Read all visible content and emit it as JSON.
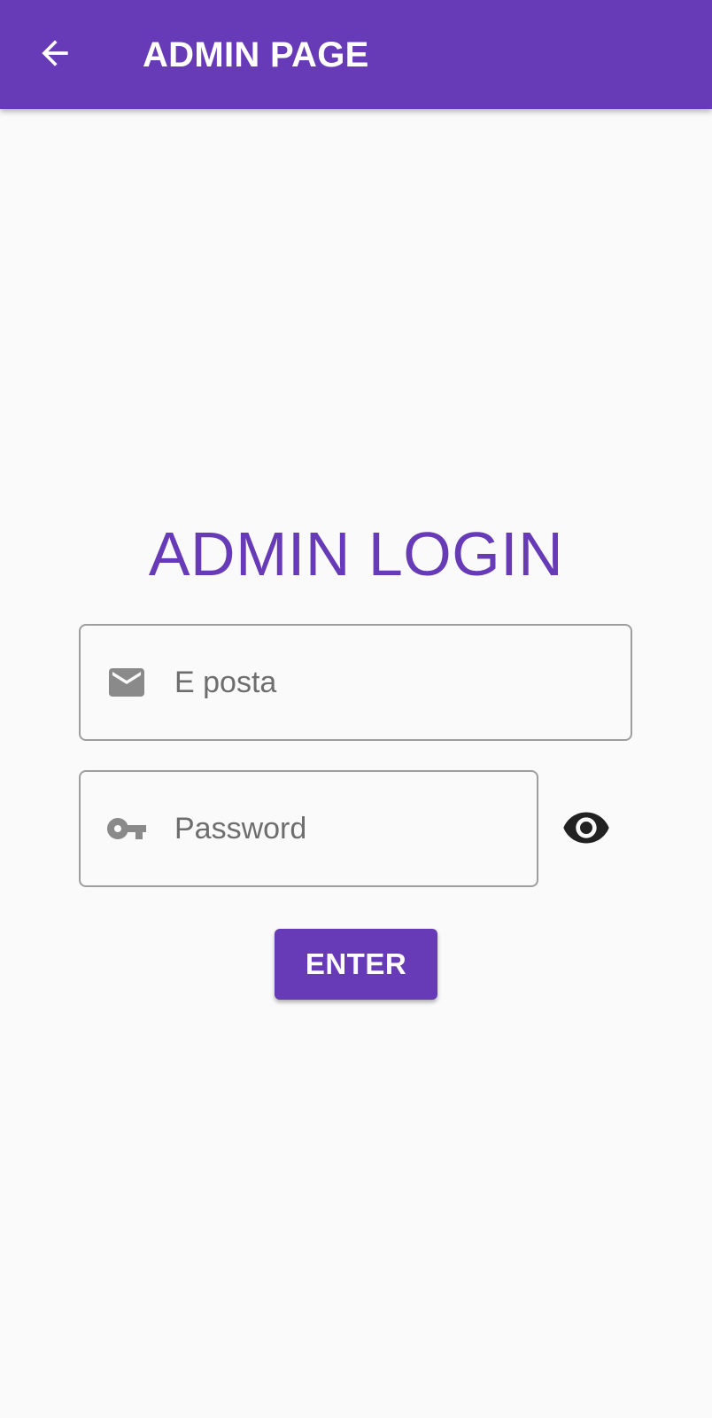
{
  "app_bar": {
    "title": "ADMIN PAGE",
    "back_icon": "arrow-back-icon",
    "background_color": "#673ab7"
  },
  "login": {
    "heading": "ADMIN LOGIN",
    "heading_color": "#673ab7",
    "email": {
      "icon": "email-icon",
      "placeholder": "E posta",
      "value": ""
    },
    "password": {
      "icon": "key-icon",
      "placeholder": "Password",
      "value": "",
      "visibility_icon": "eye-icon"
    },
    "submit_label": "ENTER",
    "accent_color": "#673ab7"
  }
}
